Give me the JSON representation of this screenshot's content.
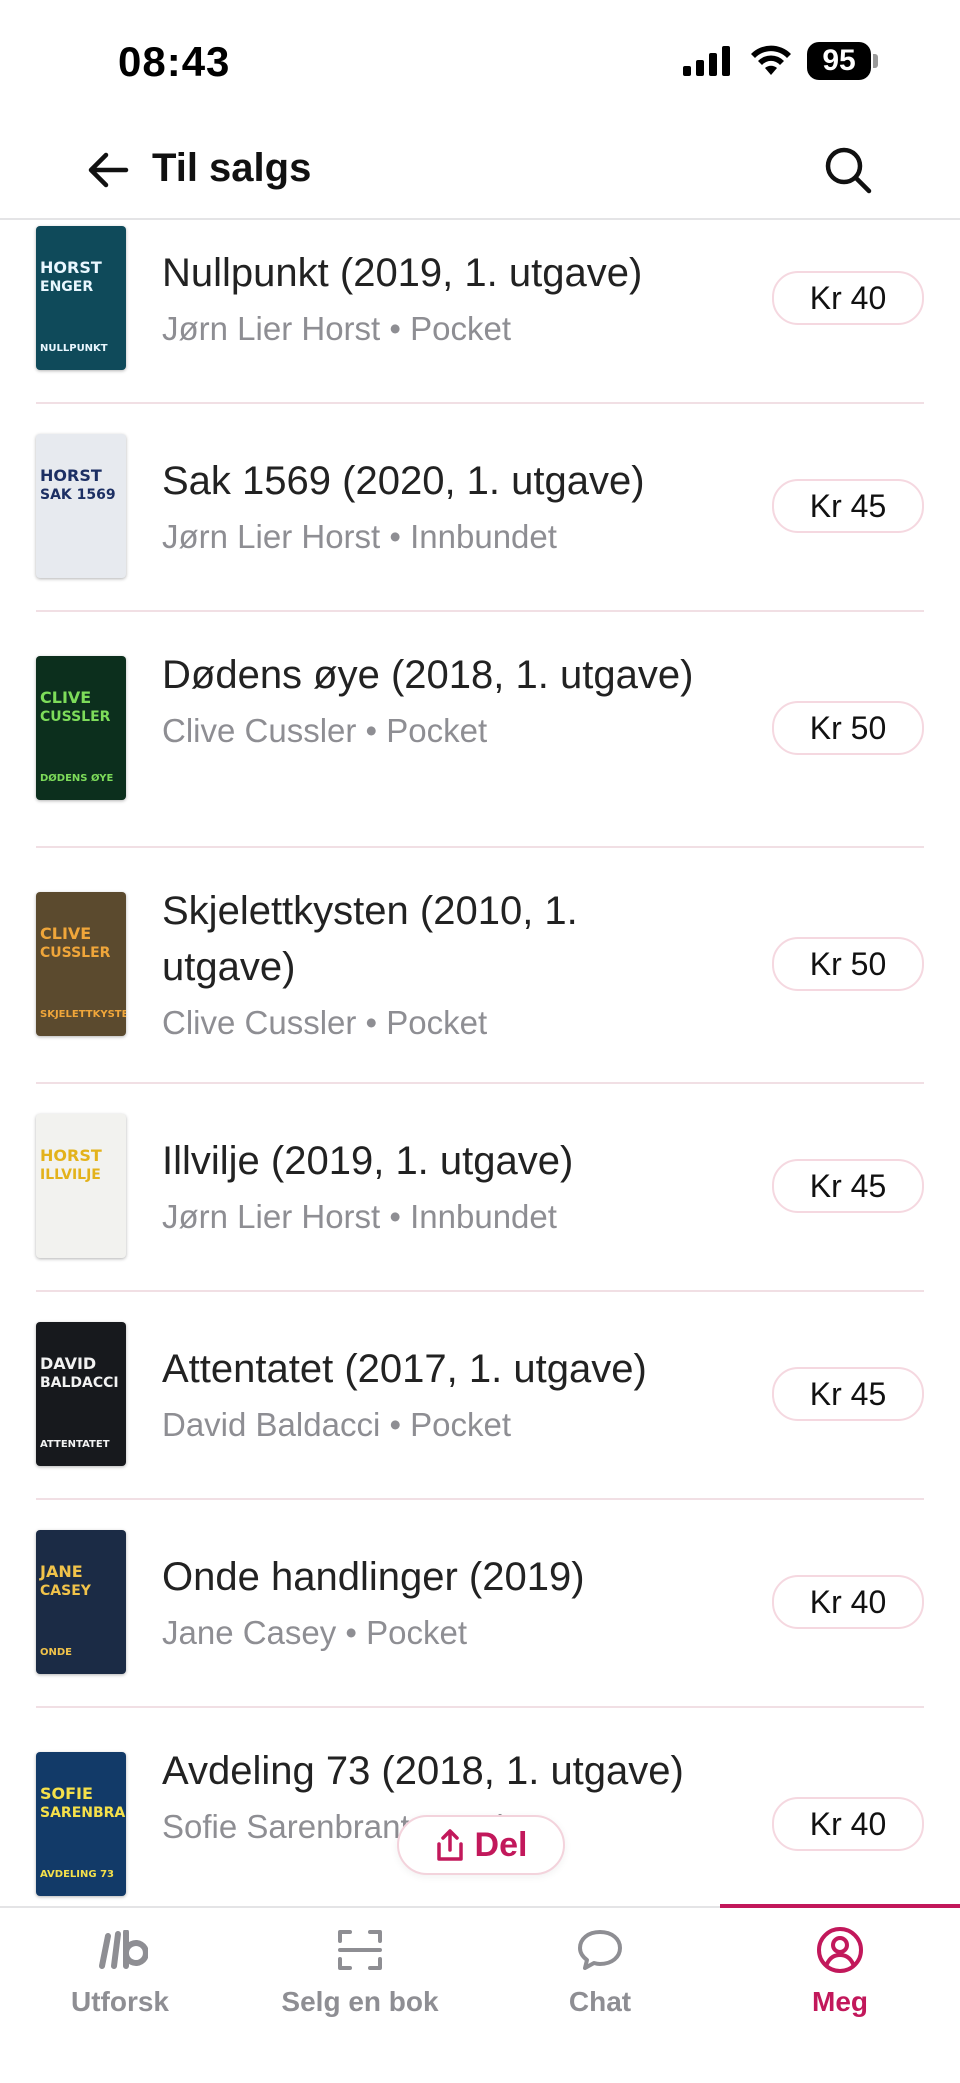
{
  "status_bar": {
    "time": "08:43",
    "battery": "95"
  },
  "header": {
    "title": "Til salgs"
  },
  "books": [
    {
      "title": "Nullpunkt (2019, 1. utgave)",
      "author": "Jørn Lier Horst",
      "format": "Pocket",
      "price": "Kr 40",
      "cover": {
        "bg": "#0f4a5a",
        "accent": "#e9f7ff",
        "line1": "HORST",
        "line2": "ENGER",
        "line3": "NULLPUNKT"
      }
    },
    {
      "title": "Sak 1569 (2020, 1. utgave)",
      "author": "Jørn Lier Horst",
      "format": "Innbundet",
      "price": "Kr 45",
      "cover": {
        "bg": "#e7eaef",
        "accent": "#1c2f63",
        "line1": "HORST",
        "line2": "SAK 1569",
        "line3": ""
      }
    },
    {
      "title": "Dødens øye (2018, 1. utgave)",
      "author": "Clive Cussler",
      "format": "Pocket",
      "price": "Kr 50",
      "cover": {
        "bg": "#0c2f1d",
        "accent": "#7ddc5a",
        "line1": "CLIVE",
        "line2": "CUSSLER",
        "line3": "DØDENS ØYE"
      }
    },
    {
      "title": "Skjelettkysten (2010, 1. utgave)",
      "author": "Clive Cussler",
      "format": "Pocket",
      "price": "Kr 50",
      "cover": {
        "bg": "#5b4a2e",
        "accent": "#f0a63a",
        "line1": "CLIVE",
        "line2": "CUSSLER",
        "line3": "SKJELETTKYSTEN"
      }
    },
    {
      "title": "Illvilje (2019, 1. utgave)",
      "author": "Jørn Lier Horst",
      "format": "Innbundet",
      "price": "Kr 45",
      "cover": {
        "bg": "#f2f2ef",
        "accent": "#e3b21b",
        "line1": "HORST",
        "line2": "ILLVILJE",
        "line3": ""
      }
    },
    {
      "title": "Attentatet (2017, 1. utgave)",
      "author": "David Baldacci",
      "format": "Pocket",
      "price": "Kr 45",
      "cover": {
        "bg": "#17191d",
        "accent": "#f2f2f2",
        "line1": "DAVID",
        "line2": "BALDACCI",
        "line3": "ATTENTATET"
      }
    },
    {
      "title": "Onde handlinger (2019)",
      "author": "Jane Casey",
      "format": "Pocket",
      "price": "Kr 40",
      "cover": {
        "bg": "#1b2b45",
        "accent": "#f1c34a",
        "line1": "JANE",
        "line2": "CASEY",
        "line3": "ONDE"
      }
    },
    {
      "title": "Avdeling 73 (2018, 1. utgave)",
      "author": "Sofie Sarenbrant",
      "format": "Pocket",
      "price": "Kr 40",
      "cover": {
        "bg": "#123a68",
        "accent": "#f5e04a",
        "line1": "SOFIE",
        "line2": "SARENBRANT",
        "line3": "AVDELING 73"
      }
    }
  ],
  "share": {
    "label": "Del"
  },
  "tabs": [
    {
      "id": "utforsk",
      "label": "Utforsk",
      "icon": "logo-icon"
    },
    {
      "id": "selg",
      "label": "Selg en bok",
      "icon": "scan-icon"
    },
    {
      "id": "chat",
      "label": "Chat",
      "icon": "chat-icon"
    },
    {
      "id": "meg",
      "label": "Meg",
      "icon": "profile-icon",
      "active": true
    }
  ],
  "colors": {
    "accent": "#c2185b",
    "muted": "#8e8e93",
    "divider": "#f1dfe4"
  }
}
